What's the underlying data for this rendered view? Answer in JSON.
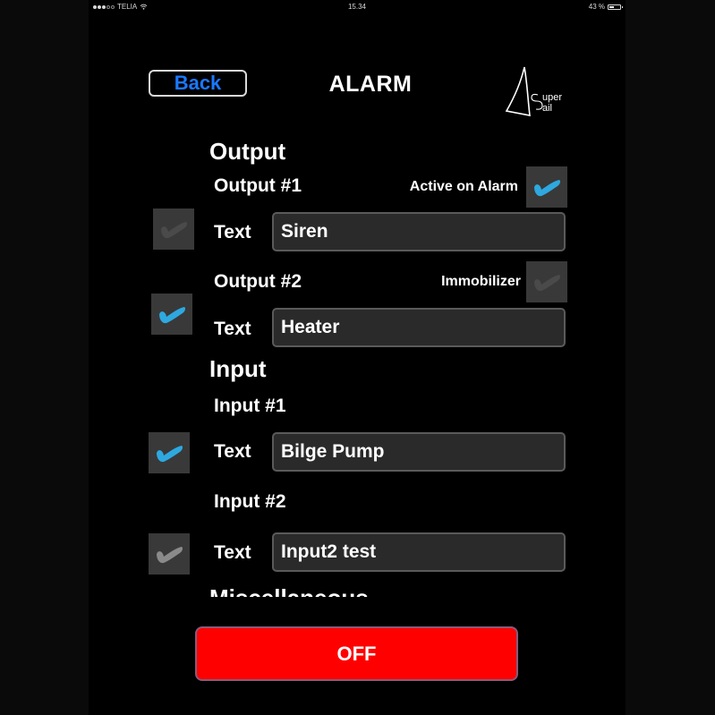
{
  "status_bar": {
    "carrier": "TELIA",
    "signal_bars_filled": 3,
    "signal_bars_total": 5,
    "time": "15.34",
    "battery_text": "43 %",
    "battery_level": 0.43
  },
  "header": {
    "back_label": "Back",
    "title": "ALARM",
    "logo_text_top": "uper",
    "logo_text_bottom": "ail"
  },
  "colors": {
    "accent_blue": "#1a78ff",
    "check_active": "#2ea8e0",
    "check_disabled": "#4a4a4a",
    "check_inactive_light": "#8a8a8a",
    "off_button": "#ff0000"
  },
  "output": {
    "heading": "Output",
    "items": [
      {
        "label": "Output #1",
        "option_label": "Active on Alarm",
        "option_checked": true,
        "text_label": "Text",
        "text_value": "Siren",
        "enabled_checked": false,
        "enabled_state": "disabled"
      },
      {
        "label": "Output #2",
        "option_label": "Immobilizer",
        "option_checked": false,
        "text_label": "Text",
        "text_value": "Heater",
        "enabled_checked": true,
        "enabled_state": "active"
      }
    ]
  },
  "input": {
    "heading": "Input",
    "items": [
      {
        "label": "Input #1",
        "text_label": "Text",
        "text_value": "Bilge Pump",
        "enabled_checked": true,
        "enabled_state": "active"
      },
      {
        "label": "Input #2",
        "text_label": "Text",
        "text_value": "Input2 test",
        "enabled_checked": false,
        "enabled_state": "inactive"
      }
    ]
  },
  "miscellaneous": {
    "heading": "Miscellaneous"
  },
  "footer": {
    "off_label": "OFF"
  }
}
